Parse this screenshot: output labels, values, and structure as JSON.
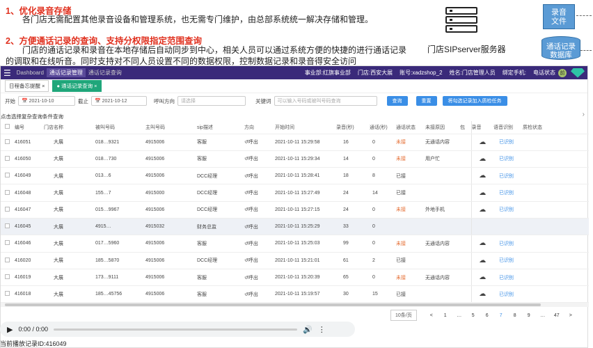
{
  "intro": {
    "p1_title": "1、优化录音存储",
    "p1_text": "各门店无需配置其他录音设备和管理系统，也无需专门维护，由总部系统统一解决存储和管理。",
    "p2_title": "2、方便通话记录的查询、支持分权限指定范围查询",
    "p2_line1": "门店的通话记录和录音在本地存储后自动同步到中心，相关人员可以通过系统方便的快捷的进行通话记录",
    "p2_line2": "的调取和在线听音。同时支持对不同人员设置不同的数据权限，控制数据记录和录音得安全访问",
    "server_label": "门店SIPserver服务器",
    "storage_label": "录音\n文件",
    "db_label": "通话记录\n数据库"
  },
  "topbar": {
    "app_name": "Dashboard",
    "crumb1": "通话记录管理",
    "crumb2": "通话记录查询",
    "division": "事业部:红旗事业部",
    "store": "门店:西安大展",
    "account": "账号:xadzshop_2",
    "name": "姓名:门店管理人员",
    "bind_phone": "绑定手机:",
    "tel_status": "电话状态",
    "avatar_text": "前"
  },
  "tabs": [
    {
      "label": "日程备忘提醒 ×"
    },
    {
      "label": "● 通话记录查询 ×"
    }
  ],
  "filter": {
    "start_label": "开始",
    "start_date": "📅 2021-10-10",
    "end_label": "截止",
    "end_date": "📅 2021-10-12",
    "direction_label": "呼叫方向",
    "direction_placeholder": "请选择",
    "keyword_label": "关键词",
    "keyword_placeholder": "可以输入号码或被叫号码查询",
    "search_btn": "查询",
    "reset_btn": "重置",
    "add_task_btn": "将勾选记录加入质检任务"
  },
  "hint": "点击选择复杂查询条件查询",
  "table": {
    "headers": [
      "编号",
      "门店名称",
      "被叫号码",
      "主叫号码",
      "sip描述",
      "方向",
      "开始时间",
      "录音(秒)",
      "通话(秒)",
      "通话状态",
      "未接原因",
      "包",
      "录音",
      "语音识别",
      "质检状态"
    ],
    "rows": [
      {
        "id": "416051",
        "store": "大展",
        "callee": "018…9321",
        "caller": "4915006",
        "sip": "客服",
        "dir": "↺呼出",
        "start": "2021-10-11 15:29:58",
        "rec": "16",
        "talk": "0",
        "status": "未接",
        "reason": "无通话内容",
        "cloud": true,
        "asr": "已识别",
        "dim": false
      },
      {
        "id": "416050",
        "store": "大展",
        "callee": "018…730",
        "caller": "4915006",
        "sip": "客服",
        "dir": "↺呼出",
        "start": "2021-10-11 15:29:34",
        "rec": "14",
        "talk": "0",
        "status": "未接",
        "reason": "用户忙",
        "cloud": true,
        "asr": "已识别",
        "dim": false
      },
      {
        "id": "416049",
        "store": "大展",
        "callee": "013…6",
        "caller": "4915006",
        "sip": "DCC经理",
        "dir": "↺呼出",
        "start": "2021-10-11 15:28:41",
        "rec": "18",
        "talk": "8",
        "status": "已接",
        "reason": "",
        "cloud": true,
        "asr": "已识别",
        "dim": false
      },
      {
        "id": "416048",
        "store": "大展",
        "callee": "155…7",
        "caller": "4915000",
        "sip": "DCC经理",
        "dir": "↺呼出",
        "start": "2021-10-11 15:27:49",
        "rec": "24",
        "talk": "14",
        "status": "已接",
        "reason": "",
        "cloud": true,
        "asr": "已识别",
        "dim": false
      },
      {
        "id": "416047",
        "store": "大展",
        "callee": "015…9967",
        "caller": "4915006",
        "sip": "DCC经理",
        "dir": "↺呼出",
        "start": "2021-10-11 15:27:15",
        "rec": "24",
        "talk": "0",
        "status": "未接",
        "reason": "外地手机",
        "cloud": true,
        "asr": "已识别",
        "dim": false
      },
      {
        "id": "416045",
        "store": "大展",
        "callee": "4915…",
        "caller": "4915032",
        "sip": "财务总监",
        "dir": "↺呼出",
        "start": "2021-10-11 15:25:29",
        "rec": "33",
        "talk": "0",
        "status": "",
        "reason": "",
        "cloud": false,
        "asr": "",
        "dim": true
      },
      {
        "id": "416046",
        "store": "大展",
        "callee": "017…5960",
        "caller": "4915006",
        "sip": "客服",
        "dir": "↺呼出",
        "start": "2021-10-11 15:25:03",
        "rec": "99",
        "talk": "0",
        "status": "未接",
        "reason": "无通话内容",
        "cloud": true,
        "asr": "已识别",
        "dim": false
      },
      {
        "id": "416020",
        "store": "大展",
        "callee": "185…5870",
        "caller": "4915006",
        "sip": "DCC经理",
        "dir": "↺呼出",
        "start": "2021-10-11 15:21:01",
        "rec": "61",
        "talk": "2",
        "status": "已接",
        "reason": "",
        "cloud": true,
        "asr": "已识别",
        "dim": false
      },
      {
        "id": "416019",
        "store": "大展",
        "callee": "173…9111",
        "caller": "4915006",
        "sip": "客服",
        "dir": "↺呼出",
        "start": "2021-10-11 15:20:39",
        "rec": "65",
        "talk": "0",
        "status": "未接",
        "reason": "无通话内容",
        "cloud": true,
        "asr": "已识别",
        "dim": false
      },
      {
        "id": "416018",
        "store": "大展",
        "callee": "185…45756",
        "caller": "4915006",
        "sip": "客服",
        "dir": "↺呼出",
        "start": "2021-10-11 15:19:57",
        "rec": "30",
        "talk": "15",
        "status": "已接",
        "reason": "",
        "cloud": true,
        "asr": "已识别",
        "dim": false
      }
    ]
  },
  "pager": {
    "page_size": "10条/页",
    "pages": [
      "<",
      "1",
      "…",
      "5",
      "6",
      "7",
      "8",
      "9",
      "…",
      "47",
      ">"
    ],
    "current": "7"
  },
  "audio": {
    "time": "0:00 / 0:00"
  },
  "current_id": "当前播放记录ID:416049",
  "colors": {
    "topbar": "#3a2a7a",
    "accent": "#3a8ee6",
    "tab_active": "#1fa67a",
    "missed": "#e46b2f"
  }
}
